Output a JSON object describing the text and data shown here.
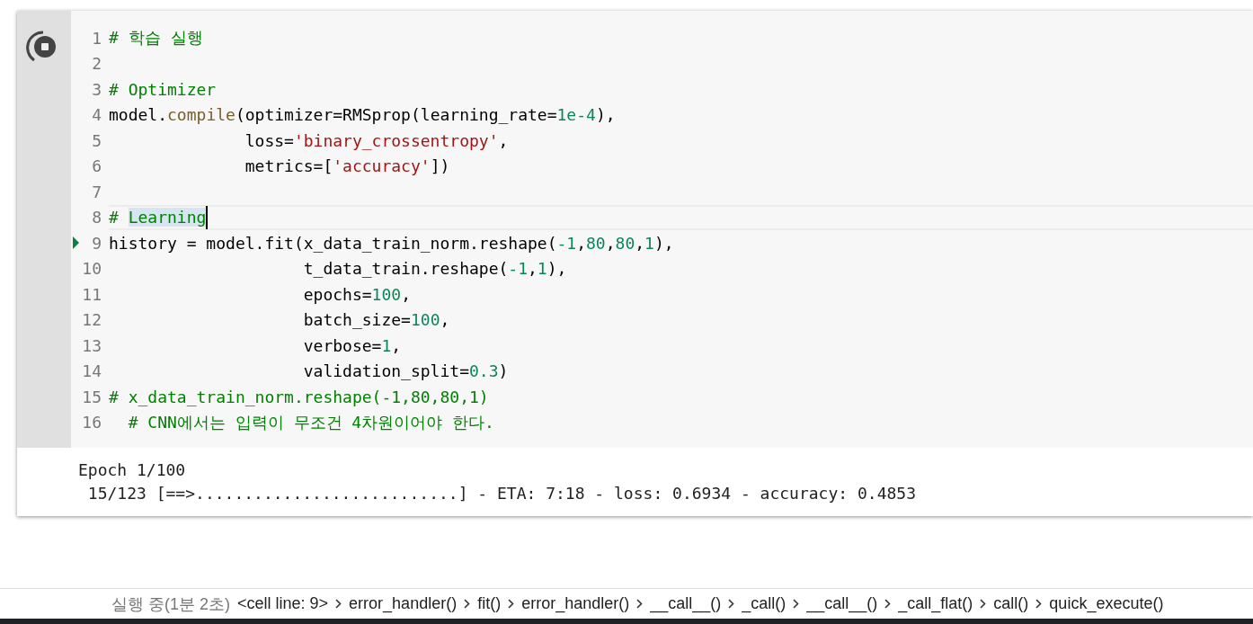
{
  "cell": {
    "running": true,
    "lines": [
      {
        "number": "1",
        "current": false,
        "executing": false,
        "tokens": [
          {
            "text": "# 학습 실행",
            "kind": "comment"
          }
        ]
      },
      {
        "number": "2",
        "current": false,
        "executing": false
      },
      {
        "number": "3",
        "current": false,
        "executing": false,
        "tokens": [
          {
            "text": "# Optimizer",
            "kind": "comment"
          }
        ]
      },
      {
        "number": "4",
        "current": false,
        "executing": false,
        "tokens": [
          {
            "text": "model.",
            "kind": "plain"
          },
          {
            "text": "compile",
            "kind": "function"
          },
          {
            "text": "(optimizer=RMSprop(learning_rate=",
            "kind": "plain"
          },
          {
            "text": "1e-4",
            "kind": "number"
          },
          {
            "text": "),",
            "kind": "plain"
          }
        ]
      },
      {
        "number": "5",
        "current": false,
        "executing": false,
        "tokens": [
          {
            "text": "              loss=",
            "kind": "plain"
          },
          {
            "text": "'binary_crossentropy'",
            "kind": "string"
          },
          {
            "text": ",",
            "kind": "plain"
          }
        ]
      },
      {
        "number": "6",
        "current": false,
        "executing": false,
        "tokens": [
          {
            "text": "              metrics=[",
            "kind": "plain"
          },
          {
            "text": "'accuracy'",
            "kind": "string"
          },
          {
            "text": "])",
            "kind": "plain"
          }
        ]
      },
      {
        "number": "7",
        "current": false,
        "executing": false
      },
      {
        "number": "8",
        "current": true,
        "executing": false,
        "tokens": [
          {
            "text": "# ",
            "kind": "comment",
            "selected": false
          },
          {
            "text": "Learning",
            "kind": "comment",
            "selected": true
          }
        ]
      },
      {
        "number": "9",
        "current": false,
        "executing": true,
        "tokens": [
          {
            "text": "history = model.fit(x_data_train_norm.reshape(",
            "kind": "plain"
          },
          {
            "text": "-1",
            "kind": "number"
          },
          {
            "text": ",",
            "kind": "plain"
          },
          {
            "text": "80",
            "kind": "number"
          },
          {
            "text": ",",
            "kind": "plain"
          },
          {
            "text": "80",
            "kind": "number"
          },
          {
            "text": ",",
            "kind": "plain"
          },
          {
            "text": "1",
            "kind": "number"
          },
          {
            "text": "),",
            "kind": "plain"
          }
        ]
      },
      {
        "number": "10",
        "current": false,
        "executing": false,
        "tokens": [
          {
            "text": "                    t_data_train.reshape(",
            "kind": "plain"
          },
          {
            "text": "-1",
            "kind": "number"
          },
          {
            "text": ",",
            "kind": "plain"
          },
          {
            "text": "1",
            "kind": "number"
          },
          {
            "text": "),",
            "kind": "plain"
          }
        ]
      },
      {
        "number": "11",
        "current": false,
        "executing": false,
        "tokens": [
          {
            "text": "                    epochs=",
            "kind": "plain"
          },
          {
            "text": "100",
            "kind": "number"
          },
          {
            "text": ",",
            "kind": "plain"
          }
        ]
      },
      {
        "number": "12",
        "current": false,
        "executing": false,
        "tokens": [
          {
            "text": "                    batch_size=",
            "kind": "plain"
          },
          {
            "text": "100",
            "kind": "number"
          },
          {
            "text": ",",
            "kind": "plain"
          }
        ]
      },
      {
        "number": "13",
        "current": false,
        "executing": false,
        "tokens": [
          {
            "text": "                    verbose=",
            "kind": "plain"
          },
          {
            "text": "1",
            "kind": "number"
          },
          {
            "text": ",",
            "kind": "plain"
          }
        ]
      },
      {
        "number": "14",
        "current": false,
        "executing": false,
        "tokens": [
          {
            "text": "                    validation_split=",
            "kind": "plain"
          },
          {
            "text": "0.3",
            "kind": "number"
          },
          {
            "text": ")",
            "kind": "plain"
          }
        ]
      },
      {
        "number": "15",
        "current": false,
        "executing": false,
        "tokens": [
          {
            "text": "# x_data_train_norm.reshape(-1,80,80,1)",
            "kind": "comment"
          }
        ]
      },
      {
        "number": "16",
        "current": false,
        "executing": false,
        "tokens": [
          {
            "text": "  # CNN에서는 입력이 무조건 4차원이어야 한다.",
            "kind": "comment"
          }
        ]
      }
    ],
    "output": [
      "Epoch 1/100",
      " 15/123 [==>...........................] - ETA: 7:18 - loss: 0.6934 - accuracy: 0.4853"
    ]
  },
  "status_bar": {
    "status": "실행 중(1분 2초)",
    "call_stack": [
      "<cell line: 9>",
      "error_handler()",
      "fit()",
      "error_handler()",
      "__call__()",
      "_call()",
      "__call__()",
      "_call_flat()",
      "call()",
      "quick_execute()"
    ]
  }
}
